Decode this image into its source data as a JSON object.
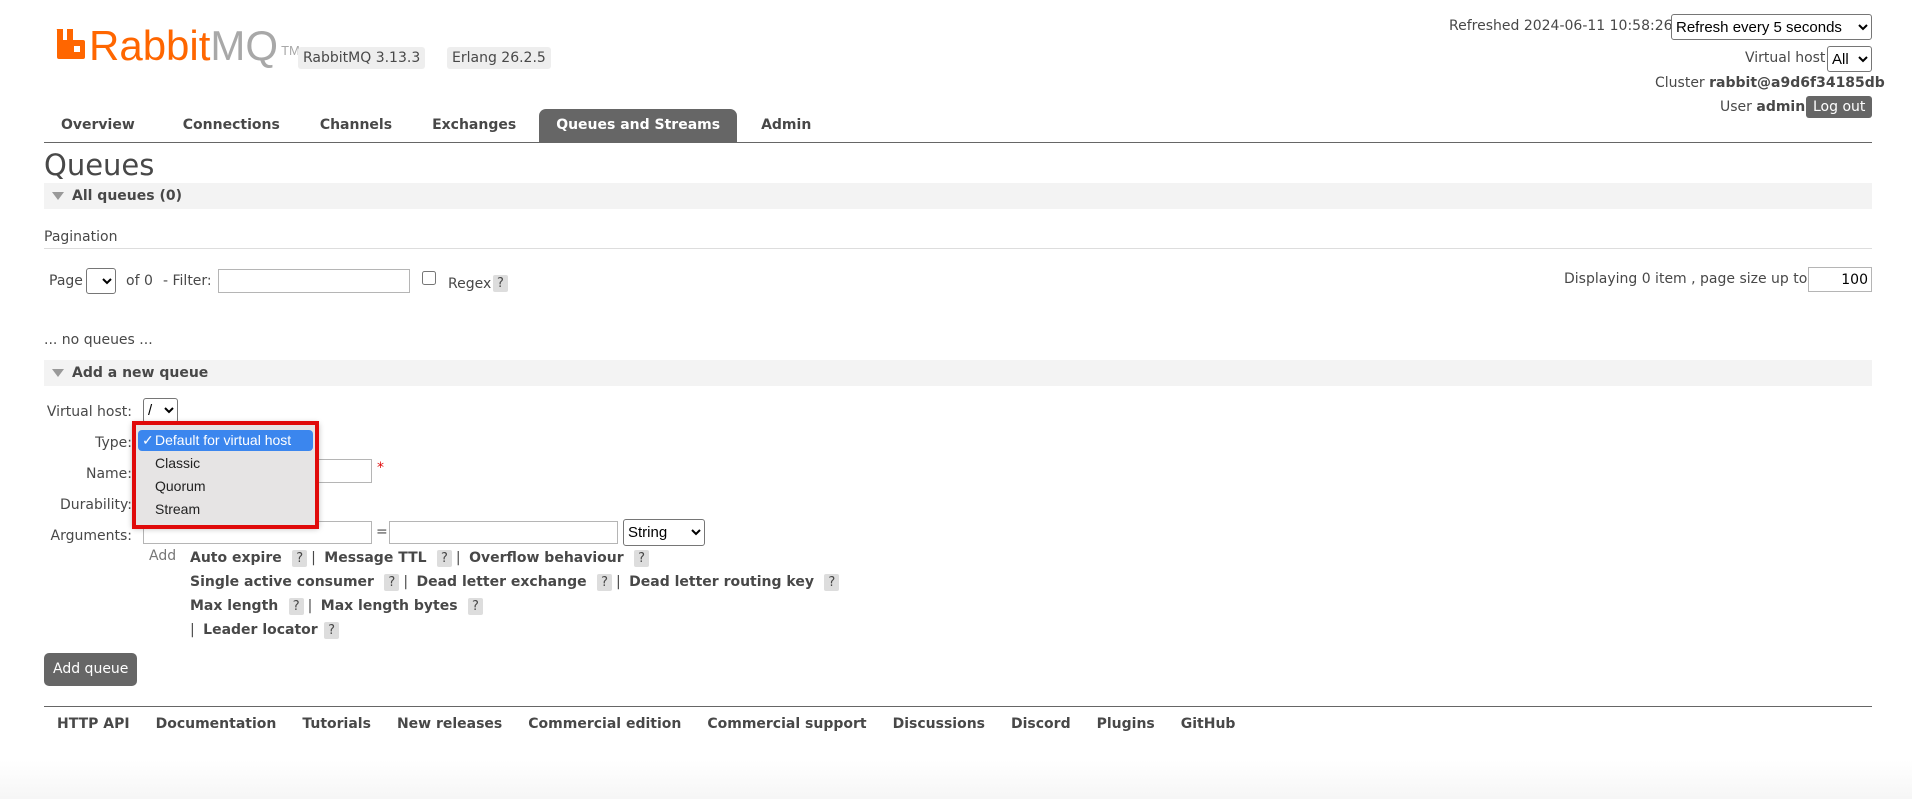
{
  "logo": {
    "brand_a": "Rabbit",
    "brand_b": "MQ",
    "tm": "TM"
  },
  "versions": {
    "rabbitmq": "RabbitMQ 3.13.3",
    "erlang": "Erlang 26.2.5"
  },
  "status": {
    "refreshed_label": "Refreshed 2024-06-11 10:58:26",
    "refresh_select": "Refresh every 5 seconds",
    "vhost_label": "Virtual host",
    "vhost_value": "All",
    "cluster_label": "Cluster",
    "cluster_value": "rabbit@a9d6f34185db",
    "user_label": "User",
    "user_value": "admin",
    "logout": "Log out"
  },
  "tabs": [
    {
      "label": "Overview"
    },
    {
      "label": "Connections"
    },
    {
      "label": "Channels"
    },
    {
      "label": "Exchanges"
    },
    {
      "label": "Queues and Streams",
      "active": true
    },
    {
      "label": "Admin"
    }
  ],
  "page_title": "Queues",
  "all_queues": {
    "title": "All queues (0)",
    "pagination_label": "Pagination",
    "page_label": "Page",
    "of_label": "of 0",
    "filter_label": "- Filter:",
    "regex_label": "Regex",
    "help": "?",
    "displaying": "Displaying 0 item , page size up to:",
    "page_size": "100",
    "empty": "... no queues ..."
  },
  "add_queue": {
    "title": "Add a new queue",
    "vhost_label": "Virtual host:",
    "vhost_value": "/",
    "type_label": "Type:",
    "name_label": "Name:",
    "required_mark": "*",
    "durability_label": "Durability:",
    "arguments_label": "Arguments:",
    "equals": "=",
    "arg_type": "String",
    "add_label": "Add",
    "arg_links": {
      "auto_expire": "Auto expire",
      "message_ttl": "Message TTL",
      "overflow": "Overflow behaviour",
      "single_active": "Single active consumer",
      "dlx": "Dead letter exchange",
      "dlrk": "Dead letter routing key",
      "max_length": "Max length",
      "max_length_bytes": "Max length bytes",
      "leader_locator": "Leader locator"
    },
    "separator": "|",
    "submit": "Add queue"
  },
  "type_dropdown": {
    "check": "✓",
    "options": [
      "Default for virtual host",
      "Classic",
      "Quorum",
      "Stream"
    ],
    "selected_index": 0
  },
  "footer": [
    "HTTP API",
    "Documentation",
    "Tutorials",
    "New releases",
    "Commercial edition",
    "Commercial support",
    "Discussions",
    "Discord",
    "Plugins",
    "GitHub"
  ],
  "colors": {
    "brand": "#ff6600",
    "tab_active": "#666666",
    "highlight": "#e00a0a",
    "dropdown_selected": "#3b86ee"
  }
}
